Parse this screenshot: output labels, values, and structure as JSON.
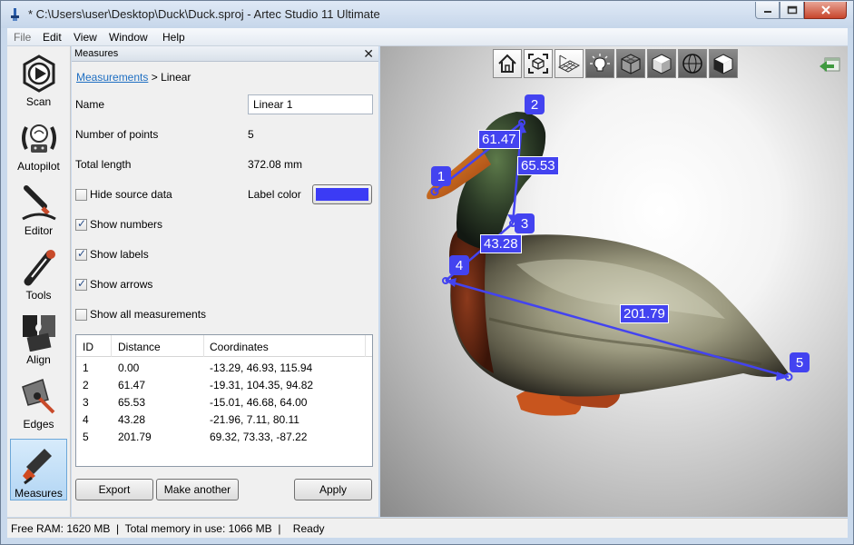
{
  "window": {
    "title": "* C:\\Users\\user\\Desktop\\Duck\\Duck.sproj - Artec Studio 11 Ultimate"
  },
  "menu": {
    "items": [
      "File",
      "Edit",
      "View",
      "Window",
      "Help"
    ]
  },
  "toolbar": {
    "tools": [
      {
        "label": "Scan",
        "icon": "scan-icon"
      },
      {
        "label": "Autopilot",
        "icon": "autopilot-icon"
      },
      {
        "label": "Editor",
        "icon": "editor-icon"
      },
      {
        "label": "Tools",
        "icon": "tools-icon"
      },
      {
        "label": "Align",
        "icon": "align-icon"
      },
      {
        "label": "Edges",
        "icon": "edges-icon"
      },
      {
        "label": "Measures",
        "icon": "measures-icon",
        "active": true
      }
    ]
  },
  "panel": {
    "title": "Measures",
    "close_glyph": "✕",
    "breadcrumb": {
      "link": "Measurements",
      "separator": " > ",
      "current": "Linear"
    },
    "name_label": "Name",
    "name_value": "Linear 1",
    "points_label": "Number of points",
    "points_value": "5",
    "length_label": "Total length",
    "length_value": "372.08 mm",
    "label_color_label": "Label color",
    "label_color": "#3b3bf5",
    "checkboxes": [
      {
        "label": "Hide source data",
        "checked": false
      },
      {
        "label": "Show numbers",
        "checked": true
      },
      {
        "label": "Show labels",
        "checked": true
      },
      {
        "label": "Show arrows",
        "checked": true
      },
      {
        "label": "Show all measurements",
        "checked": false
      }
    ],
    "table": {
      "headers": [
        "ID",
        "Distance",
        "Coordinates"
      ],
      "rows": [
        [
          "1",
          "0.00",
          "-13.29, 46.93, 115.94"
        ],
        [
          "2",
          "61.47",
          "-19.31, 104.35, 94.82"
        ],
        [
          "3",
          "65.53",
          "-15.01, 46.68, 64.00"
        ],
        [
          "4",
          "43.28",
          "-21.96, 7.11, 80.11"
        ],
        [
          "5",
          "201.79",
          "69.32, 73.33, -87.22"
        ]
      ]
    },
    "buttons": {
      "export": "Export",
      "make_another": "Make another",
      "apply": "Apply"
    }
  },
  "viewport": {
    "toolbar_icons": [
      "home-view-icon",
      "fit-view-icon",
      "grid-icon",
      "light-icon",
      "wireframe-cube-icon",
      "solid-cube-icon",
      "sphere-icon",
      "textured-cube-icon"
    ],
    "measure_labels": [
      "61.47",
      "65.53",
      "43.28",
      "201.79"
    ],
    "point_numbers": [
      "1",
      "2",
      "3",
      "4",
      "5"
    ],
    "measure_color": "#4343f0"
  },
  "status": {
    "text": "Free RAM: 1620 MB  |  Total memory in use: 1066 MB  |    Ready"
  }
}
